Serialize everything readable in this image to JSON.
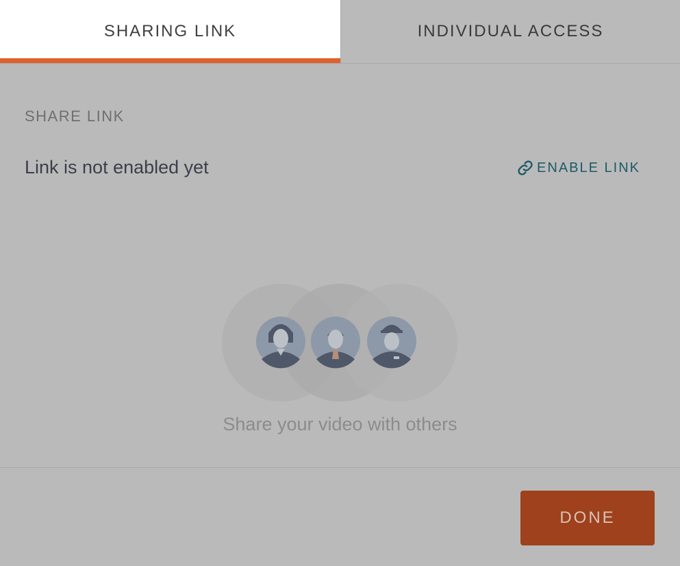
{
  "tabs": [
    {
      "label": "SHARING LINK",
      "active": true
    },
    {
      "label": "INDIVIDUAL ACCESS",
      "active": false
    }
  ],
  "share": {
    "section_label": "SHARE LINK",
    "status": "Link is not enabled yet",
    "enable_label": "ENABLE LINK",
    "enable_icon": "link-icon"
  },
  "empty_state": {
    "caption": "Share your video with others",
    "avatars": [
      "woman-avatar-icon",
      "man-avatar-icon",
      "worker-avatar-icon"
    ]
  },
  "footer": {
    "done_label": "DONE"
  },
  "colors": {
    "accent": "#e0602e",
    "done_button": "#9e411c",
    "link": "#1d5a66",
    "overlay_bg": "#bababa"
  }
}
